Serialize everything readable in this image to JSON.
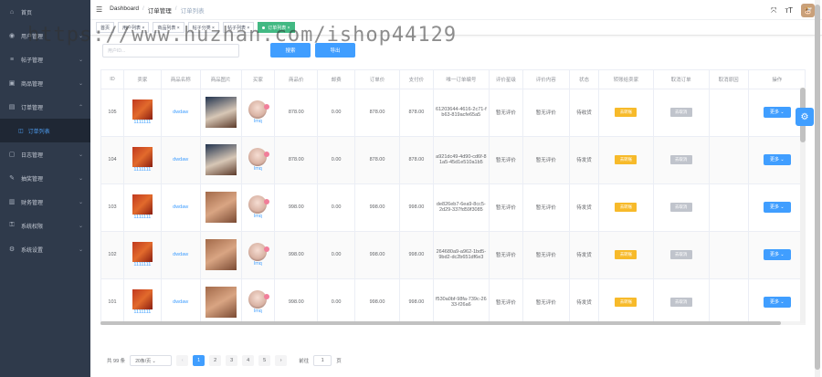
{
  "sidebar": {
    "items": [
      {
        "label": "首页",
        "icon": "home-icon",
        "glyph": "⌂",
        "arrow": ""
      },
      {
        "label": "用户管理",
        "icon": "user-icon",
        "glyph": "◉",
        "arrow": "⌄"
      },
      {
        "label": "帖子管理",
        "icon": "list-icon",
        "glyph": "≡",
        "arrow": "⌄"
      },
      {
        "label": "商品管理",
        "icon": "box-icon",
        "glyph": "▣",
        "arrow": "⌄"
      },
      {
        "label": "订单管理",
        "icon": "order-icon",
        "glyph": "▤",
        "arrow": "⌃"
      }
    ],
    "sub_item": {
      "label": "订单列表",
      "glyph": "◫"
    },
    "items2": [
      {
        "label": "日志管理",
        "icon": "log-icon",
        "glyph": "▢",
        "arrow": "⌄"
      },
      {
        "label": "抽奖管理",
        "icon": "gift-icon",
        "glyph": "✎",
        "arrow": "⌄"
      },
      {
        "label": "财务管理",
        "icon": "finance-icon",
        "glyph": "▥",
        "arrow": "⌄"
      },
      {
        "label": "系统权限",
        "icon": "lock-icon",
        "glyph": "⚿",
        "arrow": "⌄"
      },
      {
        "label": "系统设置",
        "icon": "gear-icon",
        "glyph": "⚙",
        "arrow": "⌄"
      }
    ]
  },
  "header": {
    "breadcrumb": [
      "Dashboard",
      "订单管理",
      "订单列表"
    ],
    "sep": "/",
    "fullscreen_glyph": "⤧",
    "font_glyph": "тT",
    "avatar_glyph": "🐮",
    "menu_glyph": "☰"
  },
  "tags": [
    {
      "label": "首页",
      "active": false
    },
    {
      "label": "用户列表 ×",
      "active": false
    },
    {
      "label": "商品列表 ×",
      "active": false
    },
    {
      "label": "帖子分类 ×",
      "active": false
    },
    {
      "label": "帖子列表 ×",
      "active": false
    },
    {
      "label": "订单列表 ×",
      "active": true
    }
  ],
  "toolbar": {
    "search_placeholder": "用户ID...",
    "search_label": "搜索",
    "export_label": "导出"
  },
  "watermark": "https://www.huzhan.com/ishop44129",
  "table": {
    "headers": [
      "ID",
      "卖家",
      "商品名称",
      "商品图片",
      "买家",
      "商品价",
      "邮费",
      "订单价",
      "支付价",
      "唯一订单编号",
      "评价星级",
      "评价内容",
      "状态",
      "转账给卖家",
      "取消订单",
      "取消原因",
      "操作"
    ],
    "rows": [
      {
        "id": "105",
        "seller": "1111111",
        "name": "dwdaw",
        "img": "pic",
        "buyer": "lmq",
        "price": "878.00",
        "postage": "0.00",
        "order": "878.00",
        "paid": "878.00",
        "no": "61203644-4616-2c71-fb63-819acfe65a5",
        "star": "暂无评价",
        "content": "暂无评价",
        "status": "待收货",
        "transfer": "去转账",
        "cancel": "去取消",
        "more": "更多 ⌄"
      },
      {
        "id": "104",
        "seller": "1111111",
        "name": "dwdaw",
        "img": "pic",
        "buyer": "lmq",
        "price": "878.00",
        "postage": "0.00",
        "order": "878.00",
        "paid": "878.00",
        "no": "a921dc49-4d90-cd6f-81a5-45d1e510a1b5",
        "star": "暂无评价",
        "content": "暂无评价",
        "status": "待发货",
        "transfer": "去转账",
        "cancel": "去取消",
        "more": "更多 ⌄"
      },
      {
        "id": "103",
        "seller": "1111111",
        "name": "dwdaw",
        "img": "dog",
        "buyer": "lmq",
        "price": "998.00",
        "postage": "0.00",
        "order": "998.00",
        "paid": "998.00",
        "no": "de826eb7-6ea9-8cc5-2d29-337fd59f3085",
        "star": "暂无评价",
        "content": "暂无评价",
        "status": "待发货",
        "transfer": "去转账",
        "cancel": "去取消",
        "more": "更多 ⌄"
      },
      {
        "id": "102",
        "seller": "1111111",
        "name": "dwdaw",
        "img": "dog",
        "buyer": "lmq",
        "price": "998.00",
        "postage": "0.00",
        "order": "998.00",
        "paid": "998.00",
        "no": "264680a9-a962-1bd5-9bd2-dc2b651df6e3",
        "star": "暂无评价",
        "content": "暂无评价",
        "status": "待发货",
        "transfer": "去转账",
        "cancel": "去取消",
        "more": "更多 ⌄"
      },
      {
        "id": "101",
        "seller": "1111111",
        "name": "dwdaw",
        "img": "dog",
        "buyer": "lmq",
        "price": "998.00",
        "postage": "0.00",
        "order": "998.00",
        "paid": "998.00",
        "no": "f530a0bf-98fa-739c-2633-f26a6",
        "star": "暂无评价",
        "content": "暂无评价",
        "status": "待发货",
        "transfer": "去转账",
        "cancel": "去取消",
        "more": "更多 ⌄"
      }
    ]
  },
  "pagination": {
    "total": "共 99 条",
    "page_size": "20条/页 ⌄",
    "prev": "‹",
    "pages": [
      "1",
      "2",
      "3",
      "4",
      "5"
    ],
    "active": "1",
    "next": "›",
    "goto_label": "前往",
    "goto_value": "1",
    "page_unit": "页"
  }
}
